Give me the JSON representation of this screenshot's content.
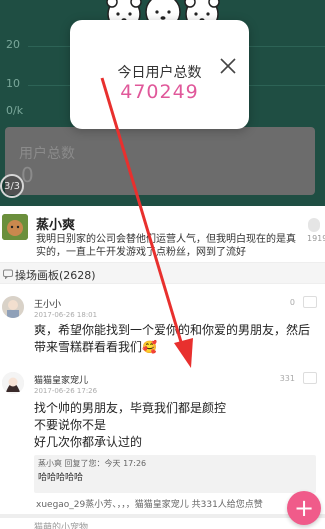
{
  "dashboard": {
    "axis_labels": [
      "20",
      "10",
      "0/k"
    ],
    "user_total_label": "用户总数",
    "user_total_value": "0",
    "page_indicator": "3/3"
  },
  "popup": {
    "title": "今日用户总数",
    "value": "470249",
    "close_icon": "close-icon"
  },
  "post": {
    "author": "蒸小爽",
    "text": "我明日别家的公司会替他们运营人气，但我明白现在的是真实的，一直上午开发游戏了点粉丝，网到了流好",
    "side_count": "1919"
  },
  "section": {
    "title": "操场画板(2628)"
  },
  "comments": [
    {
      "name": "王小小",
      "time": "2017-06-26 18:01",
      "likes": "0",
      "text": "爽，希望你能找到一个爱你的和你爱的男朋友，然后带来雪糕群看看我们🥰"
    },
    {
      "name": "猫猫皇家宠儿",
      "time": "2017-06-26 17:26",
      "likes": "331",
      "text": "找个帅的男朋友，毕竟我们都是颜控\n不要说你不是\n好几次你都承认过的"
    }
  ],
  "reply": {
    "line1": "蒸小爽 回复了您：今天 17:26",
    "line2": "哈哈哈哈哈"
  },
  "likes_line": "xuegao_29蒸小芳、，，，猫猫皇家宠儿 共331人给您点赞",
  "next_row": "猫萌的小宠物",
  "colors": {
    "accent": "#f05b8a",
    "popup_value": "#e0589a",
    "dash_bg": "#1f4e43",
    "arrow": "#e8302e"
  },
  "fab": {
    "label": "+"
  }
}
